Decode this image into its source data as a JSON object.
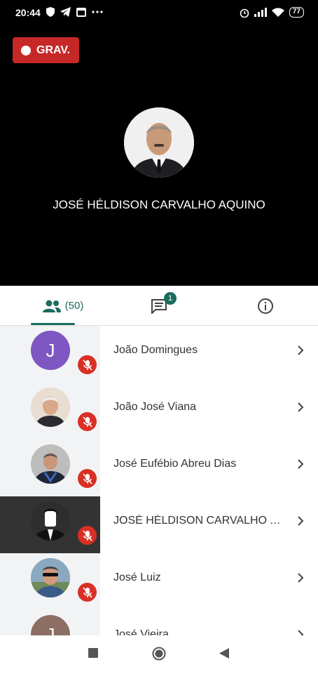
{
  "status_bar": {
    "time": "20:44",
    "battery": "77"
  },
  "recording": {
    "label": "GRAV."
  },
  "speaker": {
    "name": "JOSÉ HÉLDISON CARVALHO AQUINO"
  },
  "tabs": {
    "participants_count": "(50)",
    "chat_badge": "1"
  },
  "participants": [
    {
      "name": "João Domingues",
      "avatar": "J",
      "avatar_color": "#7e57c2"
    },
    {
      "name": "João José Viana",
      "avatar": "",
      "avatar_color": "#d9c9b5"
    },
    {
      "name": "José Eufébio Abreu Dias",
      "avatar": "",
      "avatar_color": "#c8c8c8"
    },
    {
      "name": "JOSÉ HÉLDISON CARVALHO A...",
      "avatar": "",
      "avatar_color": "#333333"
    },
    {
      "name": "José Luiz",
      "avatar": "",
      "avatar_color": "#7a9cb8"
    },
    {
      "name": "José Vieira",
      "avatar": "J",
      "avatar_color": "#8d6e63"
    }
  ],
  "colors": {
    "accent": "#1b6b5f",
    "record": "#c62828",
    "mic_muted": "#d93025"
  }
}
